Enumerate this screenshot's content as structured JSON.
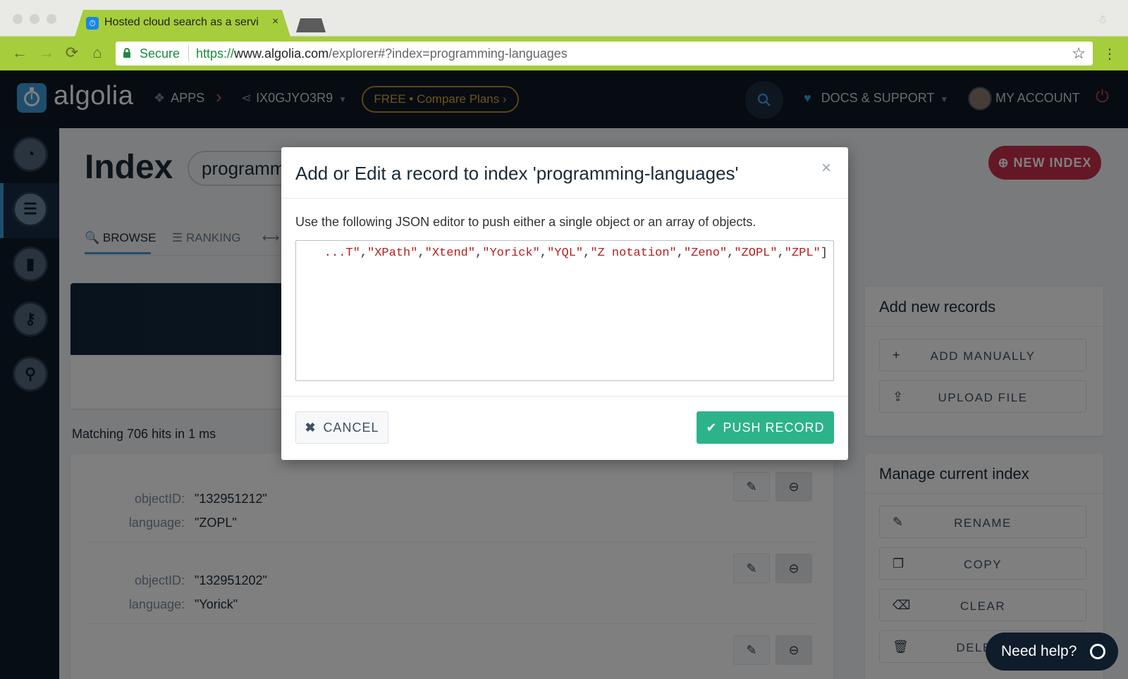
{
  "browser": {
    "tab_title": "Hosted cloud search as a servi",
    "tab_close": "×",
    "secure_label": "Secure",
    "url_scheme": "https://",
    "url_host": "www.algolia.com",
    "url_path": "/explorer#?index=programming-languages",
    "back": "←",
    "forward": "→",
    "reload": "⟳",
    "home": "⌂",
    "star": "☆",
    "menu": "⋮"
  },
  "header": {
    "logo_text": "algolia",
    "apps_label": "APPS",
    "app_id": "IX0GJYO3R9",
    "plan_label": "FREE • Compare Plans  ›",
    "docs_label": "DOCS & SUPPORT",
    "account_label": "MY ACCOUNT",
    "chevron": "›",
    "power": "⏻"
  },
  "page": {
    "title": "Index",
    "index_name": "programming-languages",
    "new_index_label": "NEW INDEX",
    "tabs": [
      {
        "label": "BROWSE",
        "icon": "🔍"
      },
      {
        "label": "RANKING",
        "icon": "☰"
      },
      {
        "label": "",
        "icon": "⟷"
      }
    ],
    "matching_text": "Matching 706 hits in 1 ms",
    "hits": [
      {
        "k1": "objectID:",
        "v1": "\"132951212\"",
        "k2": "language:",
        "v2": "\"ZOPL\""
      },
      {
        "k1": "objectID:",
        "v1": "\"132951202\"",
        "k2": "language:",
        "v2": "\"Yorick\""
      },
      {
        "k1": "",
        "v1": "",
        "k2": "",
        "v2": ""
      }
    ]
  },
  "panels": {
    "add_title": "Add new records",
    "add_manually": "ADD MANUALLY",
    "upload_file": "UPLOAD FILE",
    "manage_title": "Manage current index",
    "rename": "RENAME",
    "copy": "COPY",
    "clear": "CLEAR",
    "delete": "DELETE"
  },
  "help": {
    "label": "Need help?"
  },
  "modal": {
    "title": "Add or Edit a record to index 'programming-languages'",
    "close": "×",
    "description": "Use the following JSON editor to push either a single object or an array of objects.",
    "editor_strings": [
      "...T\"",
      "\"XPath\"",
      "\"Xtend\"",
      "\"Yorick\"",
      "\"YQL\"",
      "\"Z notation\"",
      "\"Zeno\"",
      "\"ZOPL\"",
      "\"ZPL\""
    ],
    "editor_tail": "]",
    "cancel_label": "CANCEL",
    "push_label": "PUSH RECORD"
  },
  "colors": {
    "chrome_green": "#a6cd3b",
    "brand_blue": "#3d9cdd",
    "danger_red": "#c9304a",
    "success_green": "#2cb389",
    "appbar_navy": "#0c1824"
  }
}
